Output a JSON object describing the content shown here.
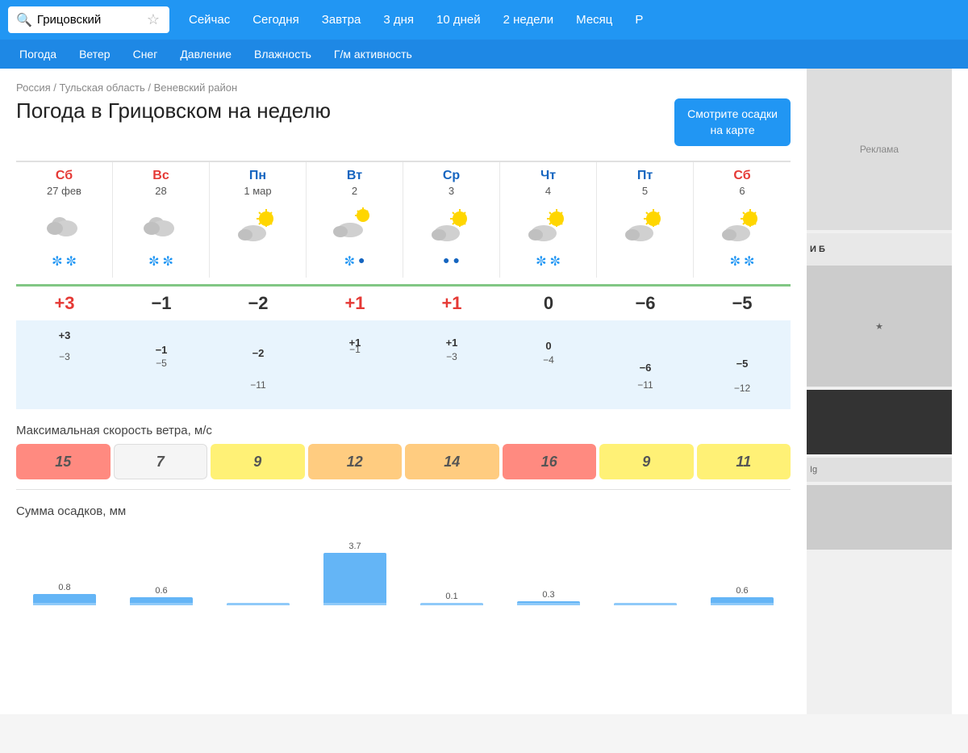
{
  "app": {
    "title": "Погода в Грицовском на неделю"
  },
  "search": {
    "value": "Грицовский",
    "placeholder": "Грицовский"
  },
  "topNav": {
    "links": [
      {
        "label": "Сейчас"
      },
      {
        "label": "Сегодня"
      },
      {
        "label": "Завтра"
      },
      {
        "label": "3 дня"
      },
      {
        "label": "10 дней"
      },
      {
        "label": "2 недели"
      },
      {
        "label": "Месяц"
      },
      {
        "label": "Р"
      }
    ]
  },
  "subNav": {
    "links": [
      {
        "label": "Погода"
      },
      {
        "label": "Ветер"
      },
      {
        "label": "Снег"
      },
      {
        "label": "Давление"
      },
      {
        "label": "Влажность"
      },
      {
        "label": "Г/м активность"
      }
    ]
  },
  "breadcrumb": {
    "parts": [
      "Россия",
      "Тульская область",
      "Веневский район"
    ]
  },
  "mapButton": {
    "line1": "Смотрите осадки",
    "line2": "на карте"
  },
  "days": [
    {
      "name": "Сб",
      "date": "27 фев",
      "type": "weekend",
      "icon": "clouds",
      "precip": [
        "❄",
        "❄"
      ],
      "precipType": "snow",
      "tempHigh": "+3",
      "tempLow": "−3",
      "tempHighNum": 3,
      "tempLowNum": -3,
      "wind": 15,
      "windClass": "wind-high",
      "precipMM": 0.8
    },
    {
      "name": "Вс",
      "date": "28",
      "type": "weekend",
      "icon": "clouds",
      "precip": [
        "❄",
        "❄"
      ],
      "precipType": "snow",
      "tempHigh": "−1",
      "tempLow": "−5",
      "tempHighNum": -1,
      "tempLowNum": -5,
      "wind": 7,
      "windClass": "wind-low",
      "precipMM": 0.6
    },
    {
      "name": "Пн",
      "date": "1 мар",
      "type": "weekday",
      "icon": "cloud-sun",
      "precip": [],
      "precipType": "none",
      "tempHigh": "−2",
      "tempLow": "−11",
      "tempHighNum": -2,
      "tempLowNum": -11,
      "wind": 9,
      "windClass": "wind-medium",
      "precipMM": 0
    },
    {
      "name": "Вт",
      "date": "2",
      "type": "weekday",
      "icon": "cloud-rain",
      "precip": [
        "❄",
        "💧"
      ],
      "precipType": "mixed",
      "tempHigh": "+1",
      "tempLow": "−1",
      "tempHighNum": 1,
      "tempLowNum": -1,
      "wind": 12,
      "windClass": "wind-medium-high",
      "precipMM": 3.7
    },
    {
      "name": "Ср",
      "date": "3",
      "type": "weekday",
      "icon": "cloud-sun",
      "precip": [
        "💧",
        "💧"
      ],
      "precipType": "rain",
      "tempHigh": "+1",
      "tempLow": "−3",
      "tempHighNum": 1,
      "tempLowNum": -3,
      "wind": 14,
      "windClass": "wind-medium-high",
      "precipMM": 0.1
    },
    {
      "name": "Чт",
      "date": "4",
      "type": "weekday",
      "icon": "cloud-sun",
      "precip": [
        "❄",
        "❄"
      ],
      "precipType": "snow",
      "tempHigh": "0",
      "tempLow": "−4",
      "tempHighNum": 0,
      "tempLowNum": -4,
      "wind": 16,
      "windClass": "wind-high",
      "precipMM": 0.3
    },
    {
      "name": "Пт",
      "date": "5",
      "type": "weekday",
      "icon": "cloud-sun",
      "precip": [],
      "precipType": "none",
      "tempHigh": "−6",
      "tempLow": "−11",
      "tempHighNum": -6,
      "tempLowNum": -11,
      "wind": 9,
      "windClass": "wind-medium",
      "precipMM": 0
    },
    {
      "name": "Сб",
      "date": "6",
      "type": "weekend",
      "icon": "cloud-sun",
      "precip": [
        "❄",
        "❄"
      ],
      "precipType": "snow",
      "tempHigh": "−5",
      "tempLow": "−12",
      "tempHighNum": -5,
      "tempLowNum": -12,
      "wind": 11,
      "windClass": "wind-medium",
      "precipMM": 0.6
    }
  ],
  "sections": {
    "wind": "Максимальная скорость ветра, м/с",
    "precip": "Сумма осадков, мм"
  }
}
